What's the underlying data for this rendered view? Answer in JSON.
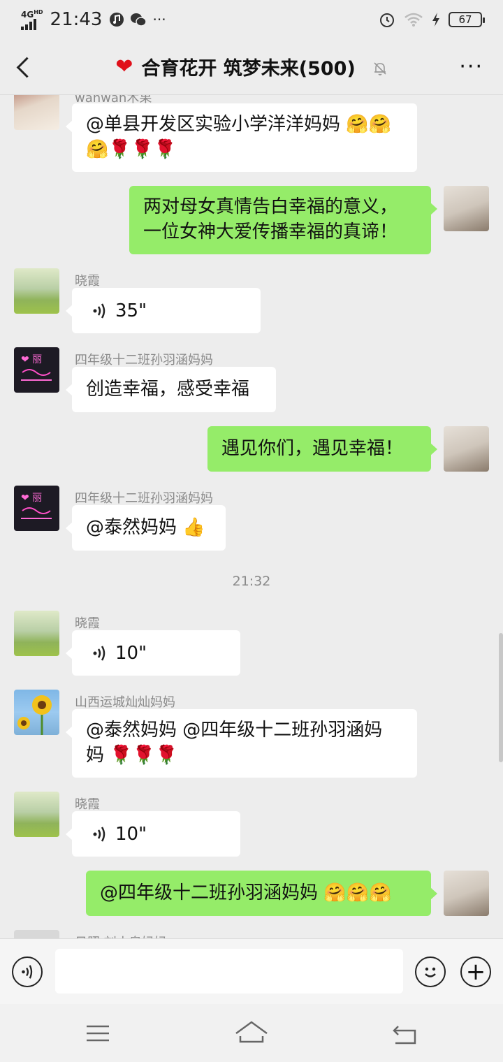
{
  "status": {
    "network": "4G",
    "network_sup": "HD",
    "time": "21:43",
    "dots": "···",
    "battery": "67"
  },
  "header": {
    "title": "合育花开 筑梦未来(500)",
    "more": "···"
  },
  "messages": [
    {
      "side": "left",
      "sender": "wanwan木果",
      "text": "@单县开发区实验小学洋洋妈妈 🤗🤗",
      "text2": "🤗🌹🌹🌹"
    },
    {
      "side": "right",
      "text": "两对母女真情告白幸福的意义，",
      "text2": "一位女神大爱传播幸福的真谛！"
    },
    {
      "side": "left",
      "sender": "晓霞",
      "voice": "35\""
    },
    {
      "side": "left",
      "sender": "四年级十二班孙羽涵妈妈",
      "text": "创造幸福，感受幸福"
    },
    {
      "side": "right",
      "text": "遇见你们，遇见幸福！"
    },
    {
      "side": "left",
      "sender": "四年级十二班孙羽涵妈妈",
      "text": "@泰然妈妈 👍"
    },
    {
      "time": "21:32"
    },
    {
      "side": "left",
      "sender": "晓霞",
      "voice": "10\""
    },
    {
      "side": "left",
      "sender": "山西运城灿灿妈妈",
      "text": "@泰然妈妈 @四年级十二班孙羽涵妈",
      "text2": "妈 🌹🌹🌹"
    },
    {
      "side": "left",
      "sender": "晓霞",
      "voice": "10\""
    },
    {
      "side": "right",
      "text": "@四年级十二班孙羽涵妈妈 🤗🤗🤗"
    },
    {
      "side": "left",
      "sender": "日照 刘小泉妈妈"
    }
  ],
  "input": {
    "placeholder": "",
    "plus": "+"
  },
  "colors": {
    "background": "#ededed",
    "bubble_self": "#95ec69",
    "bubble_other": "#ffffff",
    "heart": "#e0101a"
  },
  "icons": [
    "back-arrow-icon",
    "heart-icon",
    "mute-bell-icon",
    "more-icon",
    "voice-icon",
    "emoji-icon",
    "plus-icon",
    "menu-icon",
    "home-icon",
    "back-icon"
  ]
}
